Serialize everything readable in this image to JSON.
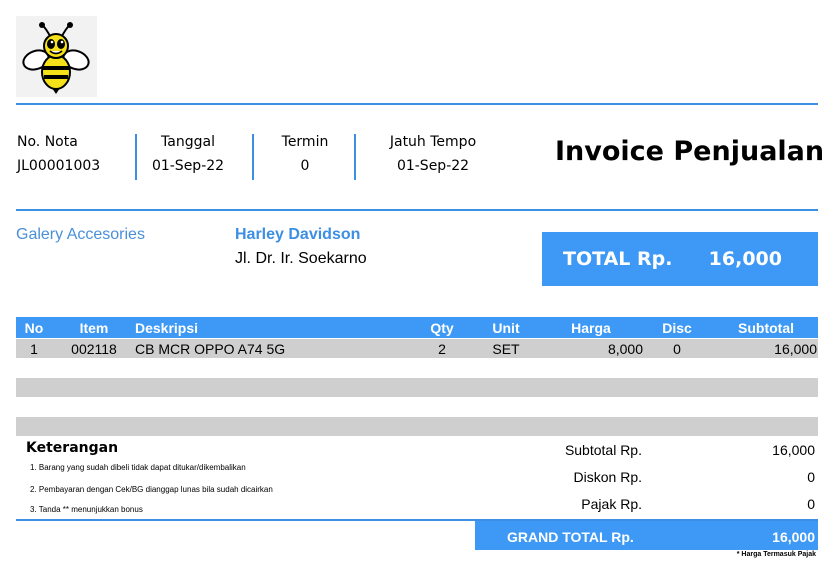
{
  "invoice": {
    "title": "Invoice Penjualan",
    "meta": [
      {
        "label": "No. Nota",
        "value": "JL00001003"
      },
      {
        "label": "Tanggal",
        "value": "01-Sep-22"
      },
      {
        "label": "Termin",
        "value": "0"
      },
      {
        "label": "Jatuh Tempo",
        "value": "01-Sep-22"
      }
    ],
    "seller": "Galery Accesories",
    "customer": {
      "name": "Harley Davidson",
      "address": "Jl. Dr. Ir. Soekarno"
    },
    "total": {
      "label": "TOTAL Rp.",
      "value": "16,000"
    }
  },
  "table": {
    "headers": {
      "no": "No",
      "item": "Item",
      "desc": "Deskripsi",
      "qty": "Qty",
      "unit": "Unit",
      "harga": "Harga",
      "disc": "Disc",
      "subtotal": "Subtotal"
    },
    "rows": [
      {
        "no": "1",
        "item": "002118",
        "desc": "CB MCR OPPO A74 5G",
        "qty": "2",
        "unit": "SET",
        "harga": "8,000",
        "disc": "0",
        "subtotal": "16,000"
      }
    ]
  },
  "notes": {
    "title": "Keterangan",
    "items": [
      "1. Barang yang sudah dibeli tidak dapat ditukar/dikembalikan",
      "2. Pembayaran dengan Cek/BG dianggap lunas bila sudah dicairkan",
      "3. Tanda ** menunjukkan bonus"
    ]
  },
  "summary": {
    "subtotal": {
      "label": "Subtotal Rp.",
      "value": "16,000"
    },
    "diskon": {
      "label": "Diskon Rp.",
      "value": "0"
    },
    "pajak": {
      "label": "Pajak Rp.",
      "value": "0"
    },
    "grand": {
      "label": "GRAND TOTAL Rp.",
      "value": "16,000"
    },
    "footnote": "* Harga Termasuk Pajak"
  },
  "icons": {
    "logo": "bee-logo-icon"
  },
  "colors": {
    "accent": "#3d99f5",
    "rule": "#3d8fe3",
    "row": "#cfcfcf"
  }
}
